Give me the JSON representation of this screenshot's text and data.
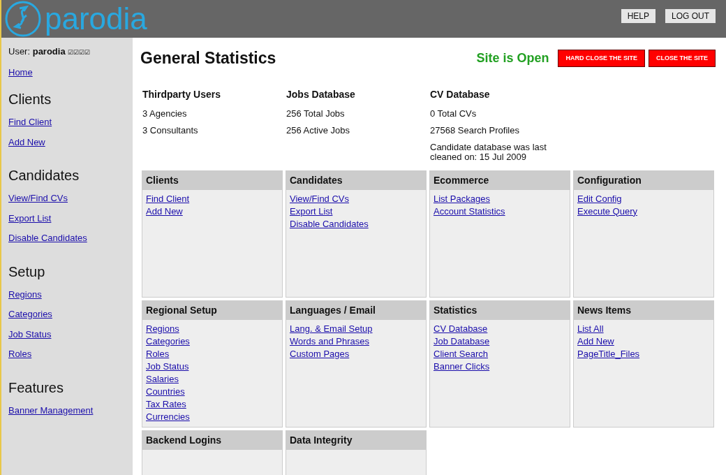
{
  "header": {
    "logo_text": "parodia",
    "buttons": [
      "HELP",
      "LOG OUT"
    ]
  },
  "sidebar": {
    "user_label": "User:",
    "user_name": "parodia",
    "user_marks": "☑☑☑☑",
    "home": "Home",
    "sections": [
      {
        "title": "Clients",
        "links": [
          "Find Client",
          "Add New"
        ]
      },
      {
        "title": "Candidates",
        "links": [
          "View/Find CVs",
          "Export List",
          "Disable Candidates"
        ]
      },
      {
        "title": "Setup",
        "links": [
          "Regions",
          "Categories",
          "Job Status",
          "Roles"
        ]
      },
      {
        "title": "Features",
        "links": [
          "Banner Management"
        ]
      }
    ]
  },
  "main": {
    "title": "General Statistics",
    "site_status": {
      "text": "Site is Open",
      "open": true
    },
    "actions": [
      "HARD CLOSE THE SITE",
      "CLOSE THE SITE"
    ],
    "stats": [
      {
        "title": "Thirdparty Users",
        "lines": [
          "3 Agencies",
          "3 Consultants"
        ]
      },
      {
        "title": "Jobs Database",
        "lines": [
          "256 Total Jobs",
          "256 Active Jobs"
        ]
      },
      {
        "title": "CV Database",
        "lines": [
          "0 Total CVs",
          "27568 Search Profiles",
          "Candidate database was last cleaned on: 15 Jul 2009"
        ]
      }
    ],
    "panels": [
      {
        "title": "Clients",
        "links": [
          "Find Client",
          "Add New"
        ]
      },
      {
        "title": "Candidates",
        "links": [
          "View/Find CVs",
          "Export List",
          "Disable Candidates"
        ]
      },
      {
        "title": "Ecommerce",
        "links": [
          "List Packages",
          "Account Statistics"
        ]
      },
      {
        "title": "Configuration",
        "links": [
          "Edit Config",
          "Execute Query"
        ]
      },
      {
        "title": "Regional Setup",
        "links": [
          "Regions",
          "Categories",
          "Roles",
          "Job Status",
          "Salaries",
          "Countries",
          "Tax Rates",
          "Currencies"
        ]
      },
      {
        "title": "Languages / Email",
        "links": [
          "Lang. & Email Setup",
          "Words and Phrases",
          "Custom Pages"
        ]
      },
      {
        "title": "Statistics",
        "links": [
          "CV Database",
          "Job Database",
          "Client Search",
          "Banner Clicks"
        ]
      },
      {
        "title": "News Items",
        "links": [
          "List All",
          "Add New",
          "PageTitle_Files"
        ]
      },
      {
        "title": "Backend Logins"
      },
      {
        "title": "Data Integrity"
      }
    ]
  }
}
